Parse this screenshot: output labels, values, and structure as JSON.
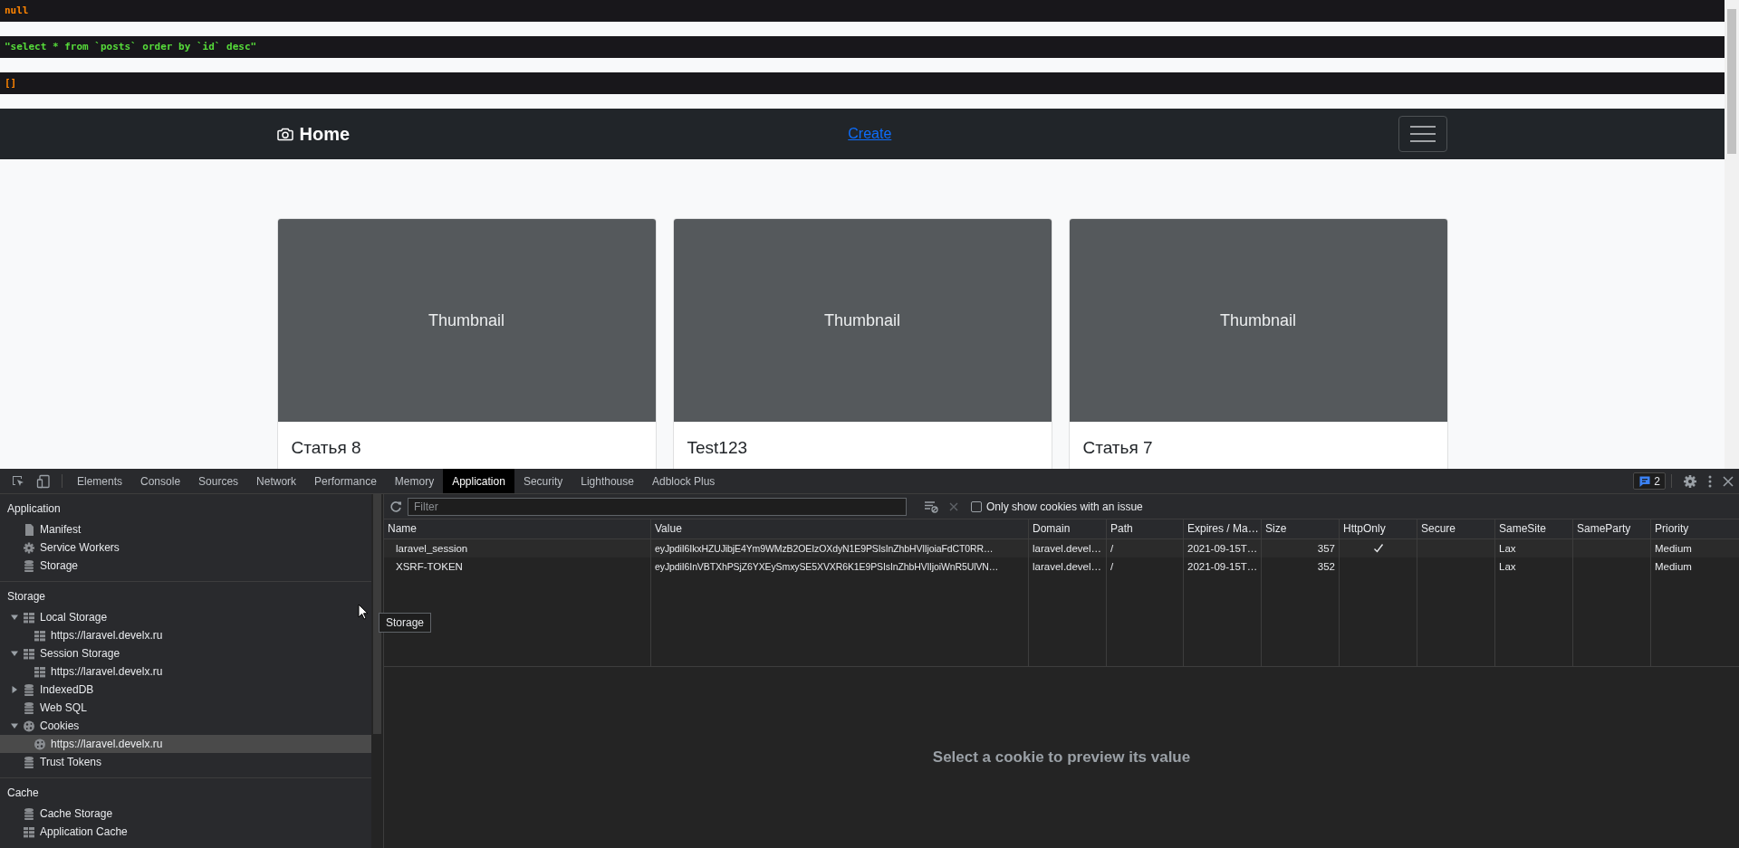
{
  "debug_dumps": [
    {
      "kind": "null",
      "text": "null"
    },
    {
      "kind": "string",
      "text": "\"select * from `posts` order by `id` desc\""
    },
    {
      "kind": "array",
      "text": "[]"
    }
  ],
  "navbar": {
    "brand": "Home",
    "link": "Create"
  },
  "cards": [
    {
      "thumbnail": "Thumbnail",
      "title": "Статья 8"
    },
    {
      "thumbnail": "Thumbnail",
      "title": "Test123"
    },
    {
      "thumbnail": "Thumbnail",
      "title": "Статья 7"
    }
  ],
  "devtools": {
    "tabs": [
      {
        "label": "Elements",
        "selected": false
      },
      {
        "label": "Console",
        "selected": false
      },
      {
        "label": "Sources",
        "selected": false
      },
      {
        "label": "Network",
        "selected": false
      },
      {
        "label": "Performance",
        "selected": false
      },
      {
        "label": "Memory",
        "selected": false
      },
      {
        "label": "Application",
        "selected": true
      },
      {
        "label": "Security",
        "selected": false
      },
      {
        "label": "Lighthouse",
        "selected": false
      },
      {
        "label": "Adblock Plus",
        "selected": false
      }
    ],
    "issues_count": "2",
    "sidebar": [
      {
        "heading": "Application",
        "items": [
          {
            "kind": "file",
            "label": "Manifest",
            "selected": false
          },
          {
            "kind": "gear",
            "label": "Service Workers",
            "selected": false
          },
          {
            "kind": "database",
            "label": "Storage",
            "selected": false
          }
        ]
      },
      {
        "heading": "Storage",
        "items": [
          {
            "kind": "grid",
            "label": "Local Storage",
            "selected": false,
            "expanded": true,
            "children": [
              {
                "kind": "grid",
                "label": "https://laravel.develx.ru",
                "selected": false
              }
            ]
          },
          {
            "kind": "grid",
            "label": "Session Storage",
            "selected": false,
            "expanded": true,
            "children": [
              {
                "kind": "grid",
                "label": "https://laravel.develx.ru",
                "selected": false
              }
            ]
          },
          {
            "kind": "database",
            "label": "IndexedDB",
            "selected": false,
            "expanded": false
          },
          {
            "kind": "database",
            "label": "Web SQL",
            "selected": false
          },
          {
            "kind": "cookie",
            "label": "Cookies",
            "selected": false,
            "expanded": true,
            "children": [
              {
                "kind": "cookie",
                "label": "https://laravel.develx.ru",
                "selected": true
              }
            ]
          },
          {
            "kind": "database",
            "label": "Trust Tokens",
            "selected": false
          }
        ]
      },
      {
        "heading": "Cache",
        "items": [
          {
            "kind": "database",
            "label": "Cache Storage",
            "selected": false
          },
          {
            "kind": "grid",
            "label": "Application Cache",
            "selected": false
          }
        ]
      }
    ],
    "tooltip": "Storage",
    "filter": {
      "placeholder": "Filter"
    },
    "issue_filter": {
      "label": "Only show cookies with an issue",
      "checked": false
    },
    "columns": [
      "Name",
      "Value",
      "Domain",
      "Path",
      "Expires / Ma…",
      "Size",
      "HttpOnly",
      "Secure",
      "SameSite",
      "SameParty",
      "Priority"
    ],
    "rows": [
      {
        "name": "laravel_session",
        "value": "eyJpdiI6IkxHZUJibjE4Ym9WMzB2OEIzOXdyN1E9PSIsInZhbHVlIjoiaFdCT0RR…",
        "domain": "laravel.devel…",
        "path": "/",
        "expires": "2021-09-15T…",
        "size": "357",
        "http_only": true,
        "same_site": "Lax",
        "priority": "Medium"
      },
      {
        "name": "XSRF-TOKEN",
        "value": "eyJpdiI6InVBTXhPSjZ6YXEySmxySE5XVXR6K1E9PSIsInZhbHVlIjoiWnR5UlVN…",
        "domain": "laravel.devel…",
        "path": "/",
        "expires": "2021-09-15T…",
        "size": "352",
        "http_only": false,
        "same_site": "Lax",
        "priority": "Medium"
      }
    ],
    "preview_message": "Select a cookie to preview its value"
  }
}
